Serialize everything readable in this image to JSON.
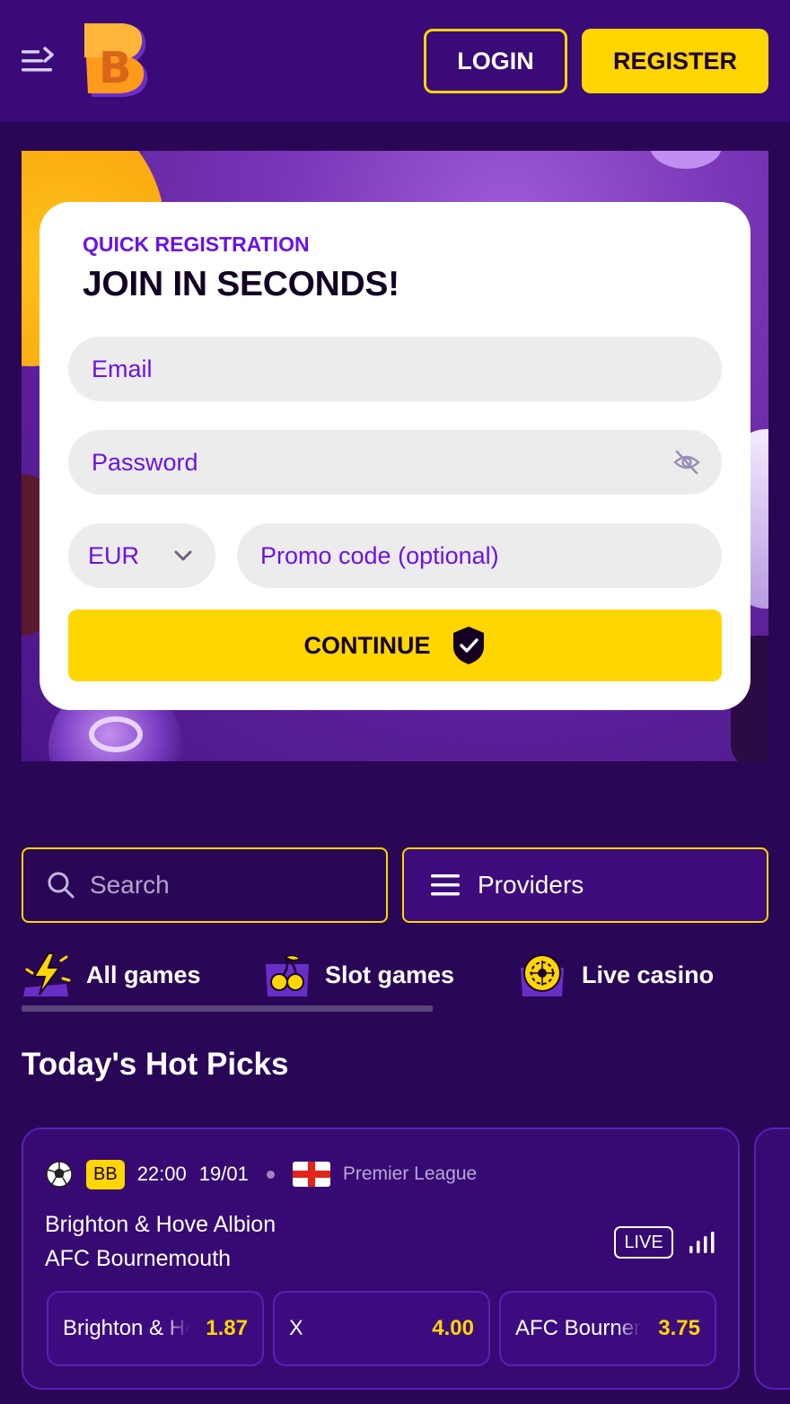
{
  "header": {
    "logo_letter": "B",
    "login_label": "LOGIN",
    "register_label": "REGISTER"
  },
  "registration": {
    "kicker": "QUICK REGISTRATION",
    "title": "JOIN IN SECONDS!",
    "email_placeholder": "Email",
    "password_placeholder": "Password",
    "currency": "EUR",
    "promo_placeholder": "Promo code (optional)",
    "continue_label": "CONTINUE"
  },
  "search": {
    "placeholder": "Search"
  },
  "providers": {
    "label": "Providers"
  },
  "tabs": [
    {
      "label": "All games",
      "active": true
    },
    {
      "label": "Slot games"
    },
    {
      "label": "Live casino"
    }
  ],
  "hot_picks": {
    "title": "Today's Hot Picks",
    "match": {
      "badge": "BB",
      "time": "22:00",
      "date": "19/01",
      "league": "Premier League",
      "team1": "Brighton & Hove Albion",
      "team2": "AFC Bournemouth",
      "live_label": "LIVE",
      "odds": [
        {
          "label": "Brighton & Hove Albion",
          "value": "1.87"
        },
        {
          "label": "X",
          "value": "4.00"
        },
        {
          "label": "AFC Bournemouth",
          "value": "3.75"
        }
      ]
    }
  },
  "colors": {
    "accent_yellow": "#ffd600",
    "brand_purple": "#3a0a78",
    "background": "#2a0756",
    "link_purple": "#6b12e8"
  }
}
